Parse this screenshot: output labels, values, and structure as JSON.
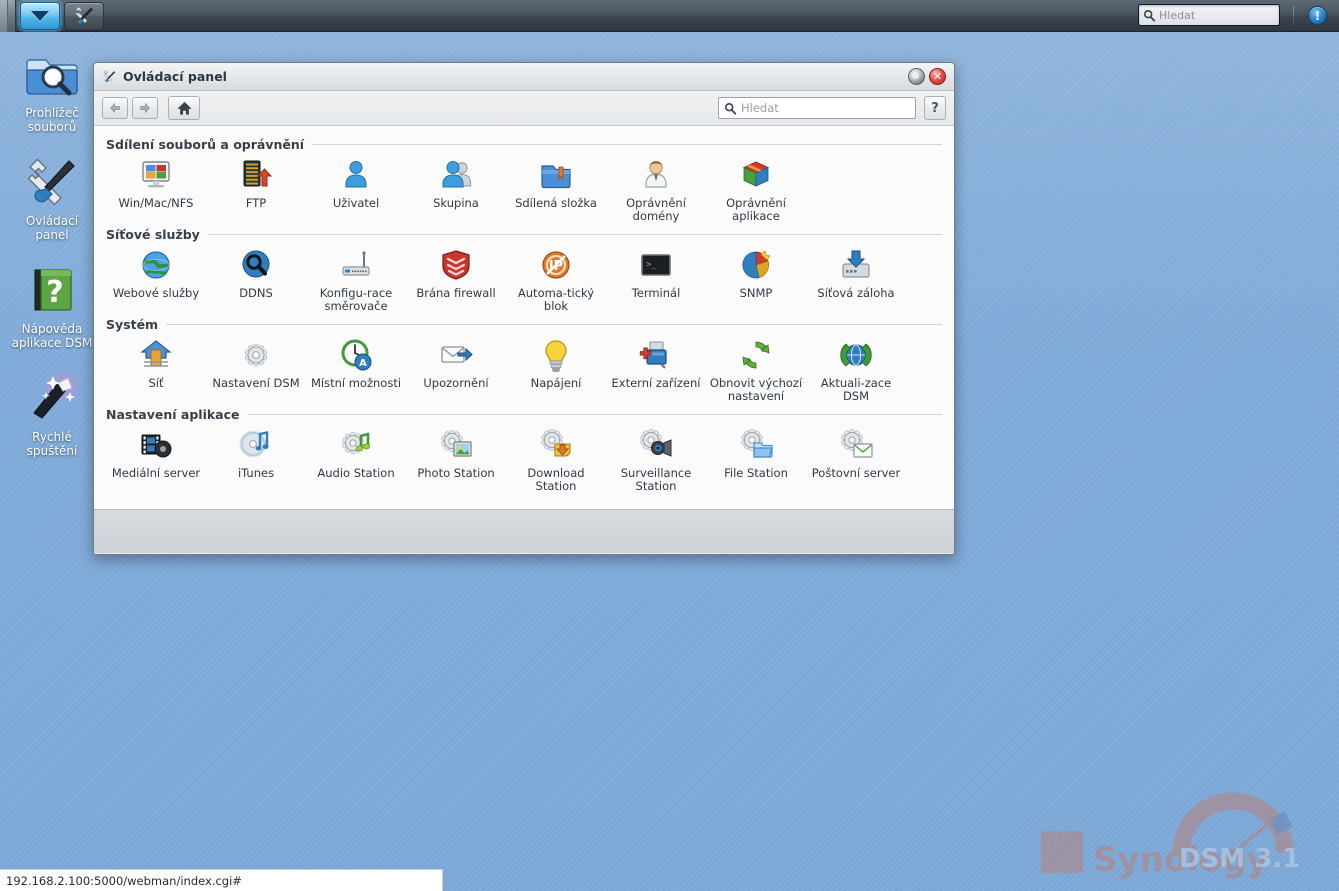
{
  "taskbar": {
    "main_menu_icon": "chevron-down-icon",
    "control_panel_icon": "tools-icon",
    "search_placeholder": "Hledat",
    "search_icon": "search-icon",
    "info_icon": "info-icon",
    "info_glyph": "!"
  },
  "desktop": {
    "icons": [
      {
        "label": "Prohlížeč\nsouborů",
        "icon": "file-browser-icon"
      },
      {
        "label": "Ovládací\npanel",
        "icon": "control-panel-icon"
      },
      {
        "label": "Nápověda\naplikace DSM",
        "icon": "help-book-icon"
      },
      {
        "label": "Rychlé\nspuštění",
        "icon": "magic-wand-icon"
      }
    ]
  },
  "window": {
    "title": "Ovládací panel",
    "title_icon": "tools-icon",
    "minimize_label": "",
    "close_label": "✕",
    "toolbar": {
      "back_icon": "arrow-left-icon",
      "forward_icon": "arrow-right-icon",
      "home_icon": "home-icon",
      "search_placeholder": "Hledat",
      "search_icon": "search-icon",
      "help_label": "?"
    },
    "sections": [
      {
        "title": "Sdílení souborů a oprávnění",
        "items": [
          {
            "label": "Win/Mac/NFS",
            "icon": "monitor-colors-icon"
          },
          {
            "label": "FTP",
            "icon": "server-upload-icon"
          },
          {
            "label": "Uživatel",
            "icon": "user-icon"
          },
          {
            "label": "Skupina",
            "icon": "group-icon"
          },
          {
            "label": "Sdílená složka",
            "icon": "shared-folder-icon"
          },
          {
            "label": "Oprávnění domény",
            "icon": "domain-user-icon"
          },
          {
            "label": "Oprávnění aplikace",
            "icon": "app-cube-icon"
          }
        ]
      },
      {
        "title": "Síťové služby",
        "items": [
          {
            "label": "Webové služby",
            "icon": "globe-icon"
          },
          {
            "label": "DDNS",
            "icon": "ddns-search-icon"
          },
          {
            "label": "Konfigu-race směrovače",
            "icon": "router-icon"
          },
          {
            "label": "Brána firewall",
            "icon": "firewall-shield-icon"
          },
          {
            "label": "Automa-tický blok",
            "icon": "auto-block-icon"
          },
          {
            "label": "Terminál",
            "icon": "terminal-icon"
          },
          {
            "label": "SNMP",
            "icon": "snmp-pie-icon"
          },
          {
            "label": "Síťová záloha",
            "icon": "network-backup-icon"
          }
        ]
      },
      {
        "title": "Systém",
        "items": [
          {
            "label": "Síť",
            "icon": "network-home-icon"
          },
          {
            "label": "Nastavení DSM",
            "icon": "gear-icon"
          },
          {
            "label": "Místní možnosti",
            "icon": "clock-region-icon"
          },
          {
            "label": "Upozornění",
            "icon": "notification-mail-icon"
          },
          {
            "label": "Napájení",
            "icon": "power-bulb-icon"
          },
          {
            "label": "Externí zařízení",
            "icon": "usb-device-icon"
          },
          {
            "label": "Obnovit výchozí nastavení",
            "icon": "restore-arrows-icon"
          },
          {
            "label": "Aktuali-zace DSM",
            "icon": "dsm-update-icon"
          }
        ]
      },
      {
        "title": "Nastavení aplikace",
        "items": [
          {
            "label": "Mediální server",
            "icon": "media-server-icon"
          },
          {
            "label": "iTunes",
            "icon": "itunes-cd-icon"
          },
          {
            "label": "Audio Station",
            "icon": "audio-station-icon"
          },
          {
            "label": "Photo Station",
            "icon": "photo-station-icon"
          },
          {
            "label": "Download Station",
            "icon": "download-station-icon"
          },
          {
            "label": "Surveillance Station",
            "icon": "surveillance-station-icon"
          },
          {
            "label": "File Station",
            "icon": "file-station-icon"
          },
          {
            "label": "Poštovní server",
            "icon": "mail-server-icon"
          }
        ]
      }
    ]
  },
  "watermark": {
    "brand": "Synology",
    "product": "DSM 3.1",
    "icon": "gauge-icon"
  },
  "status_bar": {
    "url": "192.168.2.100:5000/webman/index.cgi#"
  },
  "colors": {
    "accent": "#2c97d6",
    "desktop_blue": "#7ba7d6",
    "taskbar_dark": "#3c464f",
    "window_bg": "#fbfbfb",
    "close_red": "#b4241f",
    "watermark_orange": "#c07a6a"
  }
}
